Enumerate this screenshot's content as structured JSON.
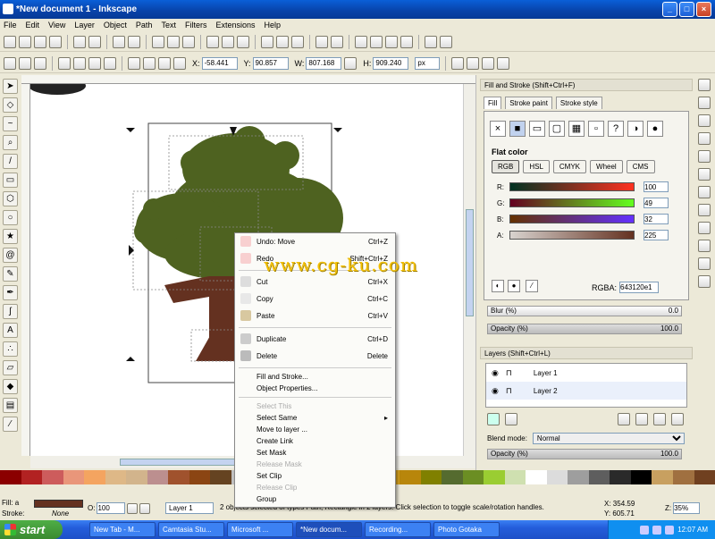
{
  "window": {
    "title": "*New document 1 - Inkscape",
    "min": "_",
    "max": "□",
    "close": "×"
  },
  "menu": [
    "File",
    "Edit",
    "View",
    "Layer",
    "Object",
    "Path",
    "Text",
    "Filters",
    "Extensions",
    "Help"
  ],
  "coords": {
    "x_label": "X:",
    "x": "-58.441",
    "y_label": "Y:",
    "y": "90.857",
    "w_label": "W:",
    "w": "807.168",
    "h_label": "H:",
    "h": "909.240",
    "unit": "px"
  },
  "fill_stroke": {
    "header": "Fill and Stroke (Shift+Ctrl+F)",
    "tabs": [
      "Fill",
      "Stroke paint",
      "Stroke style"
    ],
    "flat_color": "Flat color",
    "modes": [
      "RGB",
      "HSL",
      "CMYK",
      "Wheel",
      "CMS"
    ],
    "channels": [
      {
        "label": "R:",
        "value": "100"
      },
      {
        "label": "G:",
        "value": "49"
      },
      {
        "label": "B:",
        "value": "32"
      },
      {
        "label": "A:",
        "value": "225"
      }
    ],
    "rgba_label": "RGBA:",
    "rgba": "643120e1",
    "blur_label": "Blur (%)",
    "blur": "0.0",
    "opacity_label": "Opacity (%)",
    "opacity": "100.0"
  },
  "layers": {
    "header": "Layers (Shift+Ctrl+L)",
    "items": [
      "Layer 1",
      "Layer 2"
    ],
    "blend_label": "Blend mode:",
    "blend": "Normal",
    "opacity_label": "Opacity (%)",
    "opacity": "100.0"
  },
  "context_menu": [
    {
      "label": "Undo: Move",
      "shortcut": "Ctrl+Z",
      "icon": "undo-icon"
    },
    {
      "label": "Redo",
      "shortcut": "Shift+Ctrl+Z",
      "icon": "redo-icon"
    },
    {
      "label": "Cut",
      "shortcut": "Ctrl+X",
      "icon": "cut-icon"
    },
    {
      "label": "Copy",
      "shortcut": "Ctrl+C",
      "icon": "copy-icon"
    },
    {
      "label": "Paste",
      "shortcut": "Ctrl+V",
      "icon": "paste-icon"
    },
    {
      "label": "Duplicate",
      "shortcut": "Ctrl+D",
      "icon": "duplicate-icon"
    },
    {
      "label": "Delete",
      "shortcut": "Delete",
      "icon": "delete-icon"
    },
    {
      "label": "Fill and Stroke..."
    },
    {
      "label": "Object Properties..."
    },
    {
      "label": "Select This"
    },
    {
      "label": "Select Same"
    },
    {
      "label": "Move to layer ..."
    },
    {
      "label": "Create Link"
    },
    {
      "label": "Set Mask"
    },
    {
      "label": "Release Mask"
    },
    {
      "label": "Set Clip"
    },
    {
      "label": "Release Clip"
    },
    {
      "label": "Group"
    }
  ],
  "status": {
    "fill_label": "Fill:",
    "fill_value": "a",
    "fill_color": "#643120",
    "stroke_label": "Stroke:",
    "stroke_value": "None",
    "opacity_label": "O:",
    "opacity": "100",
    "layer": "Layer 1",
    "message": "2 objects selected of types Path, Rectangle in 2 layers. Click selection to toggle scale/rotation handles.",
    "x_label": "X:",
    "x": "354.59",
    "y_label": "Y:",
    "y": "605.71",
    "zoom_label": "Z:",
    "zoom": "35%"
  },
  "watermark": "www.cg-ku.com",
  "taskbar": {
    "start": "start",
    "tasks": [
      "New Tab - M...",
      "Camtasia Stu...",
      "Microsoft ...",
      "*New docum...",
      "Recording...",
      "Photo Gotaka"
    ],
    "clock": "12:07 AM"
  },
  "colors": {
    "tree_green": "#4e6220",
    "trunk_brown": "#643120",
    "accent_blue": "#245ddb"
  }
}
